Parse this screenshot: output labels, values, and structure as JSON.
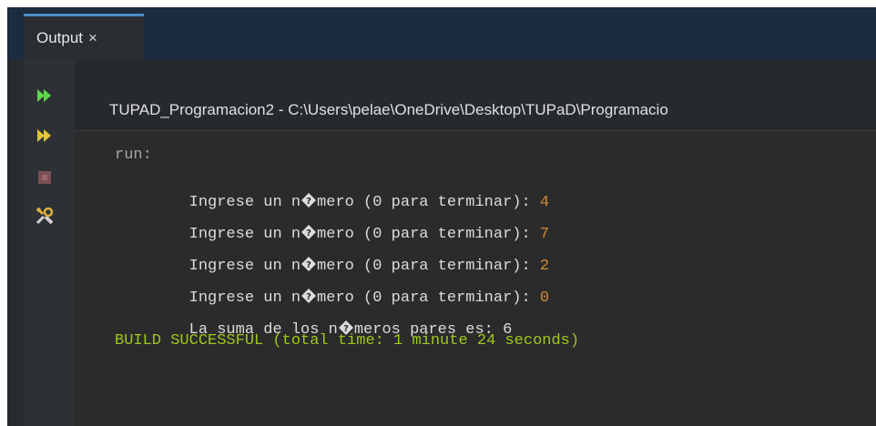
{
  "tab": {
    "label": "Output",
    "close_glyph": "×"
  },
  "toolbar": {
    "buttons": [
      {
        "name": "rerun-icon"
      },
      {
        "name": "rerun-with-different-parameters-icon"
      },
      {
        "name": "stop-icon"
      },
      {
        "name": "settings-icon"
      }
    ]
  },
  "header": {
    "text": "TUPAD_Programacion2 - C:\\Users\\pelae\\OneDrive\\Desktop\\TUPaD\\Programacio"
  },
  "console": {
    "run_label": "run:",
    "prompt_prefix": "Ingrese un n",
    "prompt_suffix": "mero (0 para terminar): ",
    "inputs": [
      "4",
      "7",
      "2",
      "0"
    ],
    "result_prefix": "La suma de los n",
    "result_suffix": "meros pares es: 6",
    "build_status": "BUILD SUCCESSFUL (total time: 1 minute 24 seconds)"
  },
  "colors": {
    "input_value": "#d48a3a",
    "build_success": "#9ec81f",
    "tab_accent": "#4b8ec8"
  }
}
